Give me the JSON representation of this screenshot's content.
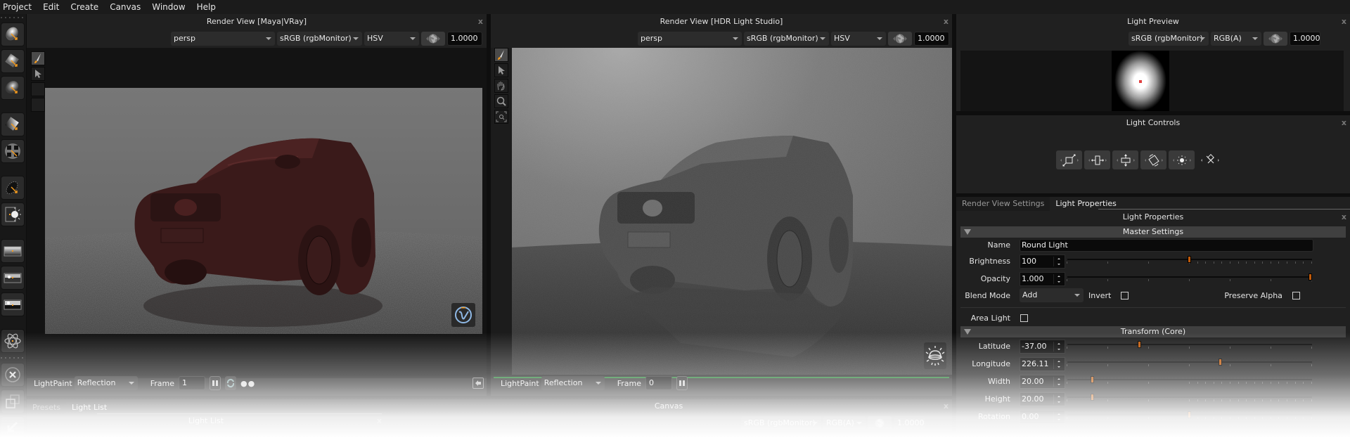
{
  "menubar": {
    "items": [
      "Project",
      "Edit",
      "Create",
      "Canvas",
      "Window",
      "Help"
    ]
  },
  "left_toolbar": {
    "tools": [
      {
        "name": "round-light-tool"
      },
      {
        "name": "square-light-tool"
      },
      {
        "name": "soft-light-tool"
      },
      {
        "name": "gradient-light-tool"
      },
      {
        "name": "pattern-light-tool"
      },
      {
        "name": "ellipse-light-tool"
      },
      {
        "name": "sun-light-tool"
      },
      {
        "name": "horizon-gradient-tool"
      },
      {
        "name": "hdri-image-tool"
      },
      {
        "name": "sky-light-tool"
      },
      {
        "name": "procedural-tool"
      },
      {
        "name": "delete-light-tool"
      },
      {
        "name": "duplicate-light-tool"
      },
      {
        "name": "undo-tool"
      }
    ]
  },
  "render_view_maya": {
    "title": "Render View [Maya|VRay]",
    "camera": "persp",
    "colorspace": "sRGB (rgbMonitor)",
    "channel": "HSV",
    "exposure": "1.0000",
    "footer": {
      "lightpaint_label": "LightPaint",
      "lightpaint_mode": "Reflection",
      "frame_label": "Frame",
      "frame_value": "1"
    },
    "badge": "vray-logo-icon"
  },
  "render_view_hdr": {
    "title": "Render View [HDR Light Studio]",
    "camera": "persp",
    "colorspace": "sRGB (rgbMonitor)",
    "channel": "HSV",
    "exposure": "1.0000",
    "footer": {
      "lightpaint_label": "LightPaint",
      "lightpaint_mode": "Reflection",
      "frame_label": "Frame",
      "frame_value": "0"
    },
    "progress": 1.0,
    "progress_color": "#1a7a2a",
    "badge": "hdr-dome-icon"
  },
  "light_preview": {
    "title": "Light Preview",
    "colorspace": "sRGB (rgbMonitor)",
    "channel": "RGB(A)",
    "exposure": "1.0000"
  },
  "light_controls": {
    "title": "Light Controls",
    "buttons": [
      "scale-icon",
      "width-icon",
      "height-icon",
      "rotate-icon",
      "brightness-icon",
      "move-icon"
    ]
  },
  "properties_tabs": {
    "tabs": [
      "Render View Settings",
      "Light Properties"
    ],
    "active": 1
  },
  "light_properties": {
    "title": "Light Properties",
    "master_section": "Master Settings",
    "name_label": "Name",
    "name_value": "Round Light",
    "brightness_label": "Brightness",
    "brightness_value": "100",
    "brightness_fraction": 0.5,
    "opacity_label": "Opacity",
    "opacity_value": "1.000",
    "opacity_fraction": 1.0,
    "blend_mode_label": "Blend Mode",
    "blend_mode_value": "Add",
    "invert_label": "Invert",
    "invert_checked": false,
    "preserve_alpha_label": "Preserve Alpha",
    "preserve_alpha_checked": false,
    "area_light_label": "Area Light",
    "area_light_checked": false,
    "transform_section": "Transform (Core)",
    "transform": [
      {
        "label": "Latitude",
        "value": "-37.00",
        "fraction": 0.294
      },
      {
        "label": "Longitude",
        "value": "226.11",
        "fraction": 0.628
      },
      {
        "label": "Width",
        "value": "20.00",
        "fraction": 0.1
      },
      {
        "label": "Height",
        "value": "20.00",
        "fraction": 0.1
      },
      {
        "label": "Rotation",
        "value": "0.00",
        "fraction": 0.5
      }
    ],
    "accent": "#c05a0a"
  },
  "bottom": {
    "tabs": [
      "Presets",
      "Light List"
    ],
    "active_tab": 1,
    "light_list_title": "Light List",
    "canvas_title": "Canvas",
    "canvas_colorspace": "sRGB (rgbMonitor)",
    "canvas_channel": "RGB(A)",
    "canvas_exposure": "1.0000"
  }
}
